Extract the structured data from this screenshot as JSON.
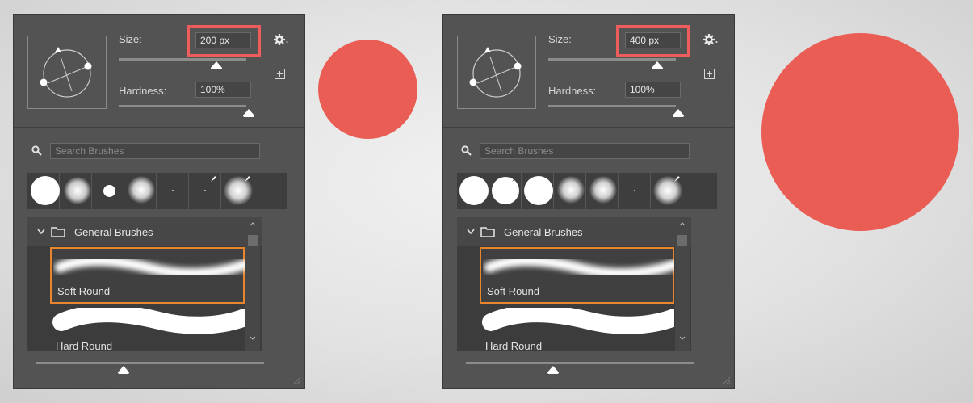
{
  "panels": [
    {
      "size_label": "Size:",
      "size_value": "200 px",
      "size_level": 0.77,
      "hardness_label": "Hardness:",
      "hardness_value": "100%",
      "hardness_level": 1.0,
      "search_placeholder": "Search Brushes",
      "group_label": "General Brushes",
      "items": [
        "Soft Round",
        "Hard Round"
      ],
      "selected_item": "Soft Round"
    },
    {
      "size_label": "Size:",
      "size_value": "400 px",
      "size_level": 0.83,
      "hardness_label": "Hardness:",
      "hardness_value": "100%",
      "hardness_level": 1.0,
      "search_placeholder": "Search Brushes",
      "group_label": "General Brushes",
      "items": [
        "Soft Round",
        "Hard Round"
      ],
      "selected_item": "Soft Round"
    }
  ],
  "colors": {
    "panel_bg": "#535353",
    "highlight_red": "#ee5c5c",
    "selection_orange": "#e9852f",
    "brush_circle": "#ea5d54"
  },
  "icons": [
    "brush-angle-preview-icon",
    "gear-icon",
    "new-preset-plus-icon",
    "search-icon",
    "chevron-down-icon",
    "folder-icon",
    "resize-grip-icon"
  ]
}
